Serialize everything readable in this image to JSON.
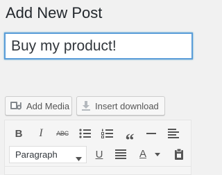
{
  "page": {
    "title": "Add New Post"
  },
  "post": {
    "title_value": "Buy my product!"
  },
  "media_buttons": {
    "add_media_label": "Add Media",
    "insert_download_label": "Insert download"
  },
  "toolbar": {
    "bold_label": "B",
    "italic_label": "I",
    "strikethrough_label": "ABC",
    "blockquote_label": "“",
    "underline_label": "U",
    "text_color_label": "A",
    "format_value": "Paragraph"
  },
  "colors": {
    "focus_border": "#5b9dd9",
    "background": "#f1f1f1",
    "icon": "#555555"
  }
}
